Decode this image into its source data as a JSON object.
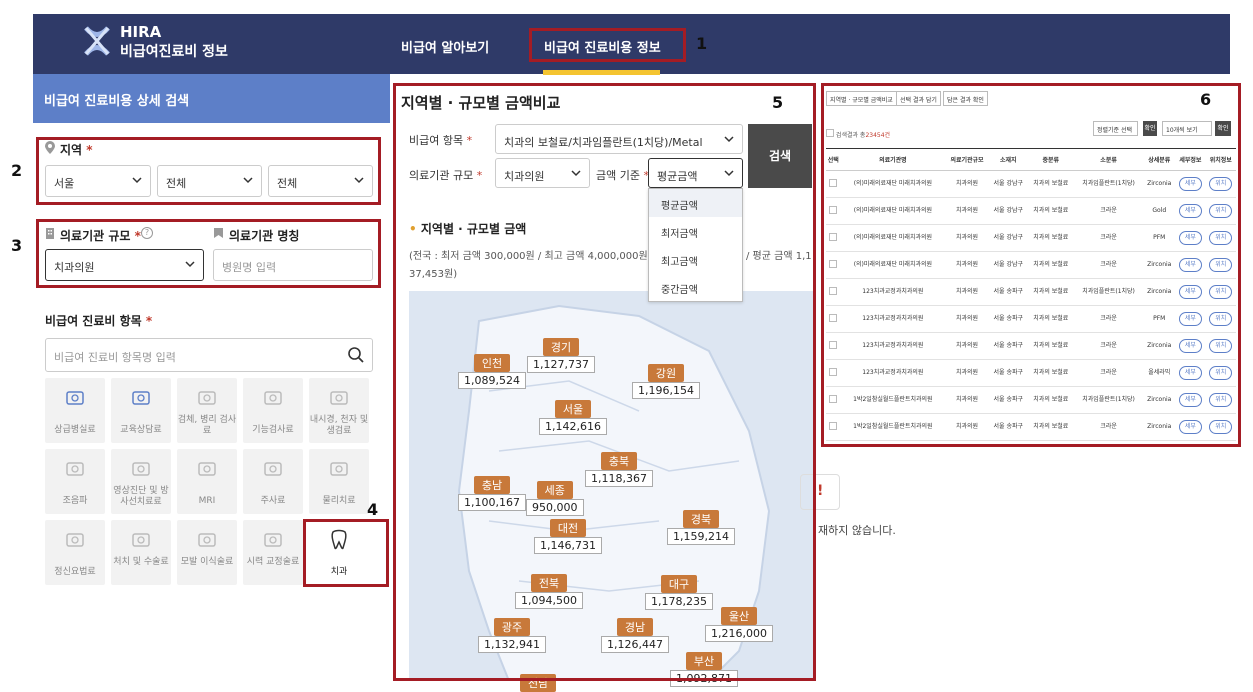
{
  "header": {
    "logo_title": "HIRA",
    "logo_sub": "비급여진료비 정보",
    "nav": [
      "비급여 알아보기",
      "비급여 진료비용 정보"
    ]
  },
  "annotations": [
    "1",
    "2",
    "3",
    "4",
    "5",
    "6"
  ],
  "left": {
    "panel_title": "비급여 진료비용 상세 검색",
    "region_label": "지역",
    "region_selects": [
      "서울",
      "전체",
      "전체"
    ],
    "inst_size_label": "의료기관 규모",
    "inst_size_value": "치과의원",
    "inst_name_label": "의료기관 명칭",
    "inst_name_placeholder": "병원명 입력",
    "item_label": "비급여 진료비 항목",
    "item_placeholder": "비급여 진료비 항목명 입력",
    "tiles": [
      [
        "상급병실료",
        "교육상담료",
        "검체, 병리 검사료",
        "기능검사료",
        "내시경, 천자 및 생검료"
      ],
      [
        "조음파",
        "영상진단 및 방사선치료료",
        "MRI",
        "주사료",
        "물리치료"
      ],
      [
        "정신요법료",
        "처치 및 수술료",
        "모발 이식술료",
        "시력 교정술료",
        "치과"
      ]
    ]
  },
  "middle": {
    "title": "지역별 · 규모별 금액비교",
    "item_label": "비급여 항목",
    "item_value": "치과의 보철료/치과임플란트(1치당)/Metal",
    "size_label": "의료기관 규모",
    "size_value": "치과의원",
    "basis_label": "금액 기준",
    "basis_value": "평균금액",
    "search_btn": "검색",
    "dropdown": [
      "평균금액",
      "최저금액",
      "최고금액",
      "중간금액"
    ],
    "section_title": "지역별 · 규모별 금액",
    "summary_l1": "(전국 : 최저 금액 300,000원 / 최고 금액 4,000,000원 / ",
    "summary_r1": "/ 평균 금액 1,1",
    "summary_l2": "37,453원)",
    "regions": [
      {
        "name": "인천",
        "value": "1,089,524"
      },
      {
        "name": "경기",
        "value": "1,127,737"
      },
      {
        "name": "강원",
        "value": "1,196,154"
      },
      {
        "name": "서울",
        "value": "1,142,616"
      },
      {
        "name": "충북",
        "value": "1,118,367"
      },
      {
        "name": "충남",
        "value": "1,100,167"
      },
      {
        "name": "세종",
        "value": "950,000"
      },
      {
        "name": "대전",
        "value": "1,146,731"
      },
      {
        "name": "경북",
        "value": "1,159,214"
      },
      {
        "name": "전북",
        "value": "1,094,500"
      },
      {
        "name": "대구",
        "value": "1,178,235"
      },
      {
        "name": "울산",
        "value": "1,216,000"
      },
      {
        "name": "광주",
        "value": "1,132,941"
      },
      {
        "name": "경남",
        "value": "1,126,447"
      },
      {
        "name": "부산",
        "value": "1,092,871"
      },
      {
        "name": "전남",
        "value": ""
      }
    ]
  },
  "right": {
    "buttons": [
      "지역별 · 규모별 금액비교",
      "선택 결과 담기",
      "담은 결과 확인"
    ],
    "result_label": "검색결과 총",
    "result_count": "23454건",
    "sort": "정렬기준 선택",
    "sort_btn": "확인",
    "per_page": "10개씩 보기",
    "per_page_btn": "확인",
    "columns": [
      "선택",
      "의료기관명",
      "의료기관규모",
      "소재지",
      "중분류",
      "소분류",
      "상세분류",
      "세부정보",
      "위치정보"
    ],
    "rows": [
      [
        "(의)미래의료재단 미래치과의원",
        "치과의원",
        "서울 강남구",
        "치과의 보철료",
        "치과임플란트(1치당)",
        "Zirconia"
      ],
      [
        "(의)미래의료재단 미래치과의원",
        "치과의원",
        "서울 강남구",
        "치과의 보철료",
        "크라운",
        "Gold"
      ],
      [
        "(의)미래의료재단 미래치과의원",
        "치과의원",
        "서울 강남구",
        "치과의 보철료",
        "크라운",
        "PFM"
      ],
      [
        "(의)미래의료재단 미래치과의원",
        "치과의원",
        "서울 강남구",
        "치과의 보철료",
        "크라운",
        "Zirconia"
      ],
      [
        "123치과교정과치과의원",
        "치과의원",
        "서울 송파구",
        "치과의 보철료",
        "치과임플란트(1치당)",
        "Zirconia"
      ],
      [
        "123치과교정과치과의원",
        "치과의원",
        "서울 송파구",
        "치과의 보철료",
        "크라운",
        "PFM"
      ],
      [
        "123치과교정과치과의원",
        "치과의원",
        "서울 송파구",
        "치과의 보철료",
        "크라운",
        "Zirconia"
      ],
      [
        "123치과교정과치과의원",
        "치과의원",
        "서울 송파구",
        "치과의 보철료",
        "크라운",
        "올세라믹"
      ],
      [
        "1박2일참실월드플란트치과의원",
        "치과의원",
        "서울 송파구",
        "치과의 보철료",
        "치과임플란트(1치당)",
        "Zirconia"
      ],
      [
        "1박2일참실월드플란트치과의원",
        "치과의원",
        "서울 송파구",
        "치과의 보철료",
        "크라운",
        "Zirconia"
      ]
    ],
    "detail_btn": "세부",
    "loc_btn": "위치"
  },
  "background_text": "재하지 않습니다.",
  "background_mark": "!"
}
